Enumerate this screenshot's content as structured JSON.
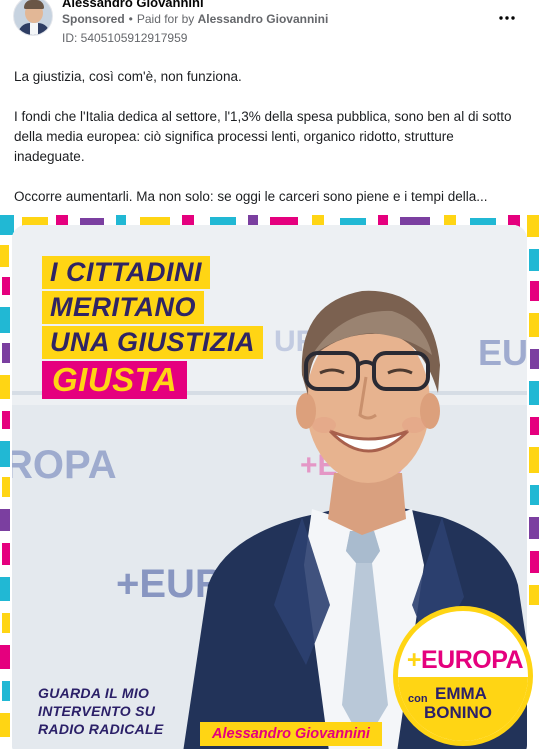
{
  "post": {
    "author": "Alessandro Giovannini",
    "sponsored_label": "Sponsored",
    "separator": "•",
    "paid_for_prefix": "Paid for by",
    "paid_for_name": "Alessandro Giovannini",
    "ad_id": "ID: 5405105912917959",
    "more_icon": "more-dots-icon"
  },
  "body": {
    "paragraphs": [
      "La giustizia, così com'è, non funziona.",
      "I fondi che l'Italia dedica al settore, l'1,3% della spesa pubblica, sono ben al di sotto della media europea: ciò significa processi lenti, organico ridotto, strutture inadeguate.",
      "Occorre aumentarli. Ma non solo: se oggi le carceri sono piene e i tempi della..."
    ]
  },
  "creative": {
    "headline": [
      "I CITTADINI",
      "MERITANO",
      "UNA GIUSTIZIA",
      "GIUSTA"
    ],
    "cta": [
      "GUARDA IL MIO",
      "INTERVENTO SU",
      "RADIO RADICALE"
    ],
    "name_tag": "Alessandro Giovannini",
    "background_wall_text_1": "ROPA",
    "background_wall_text_2": "+EURO",
    "background_wall_text_3": "EU",
    "logo": {
      "plus": "+",
      "word": "EUROPA",
      "con": "con",
      "name1": "EMMA",
      "name2": "BONINO"
    },
    "colors": {
      "yellow": "#ffd514",
      "magenta": "#e5007e",
      "navy": "#2b2068",
      "cyan": "#21b8d4",
      "purple": "#7b3fa0"
    }
  }
}
